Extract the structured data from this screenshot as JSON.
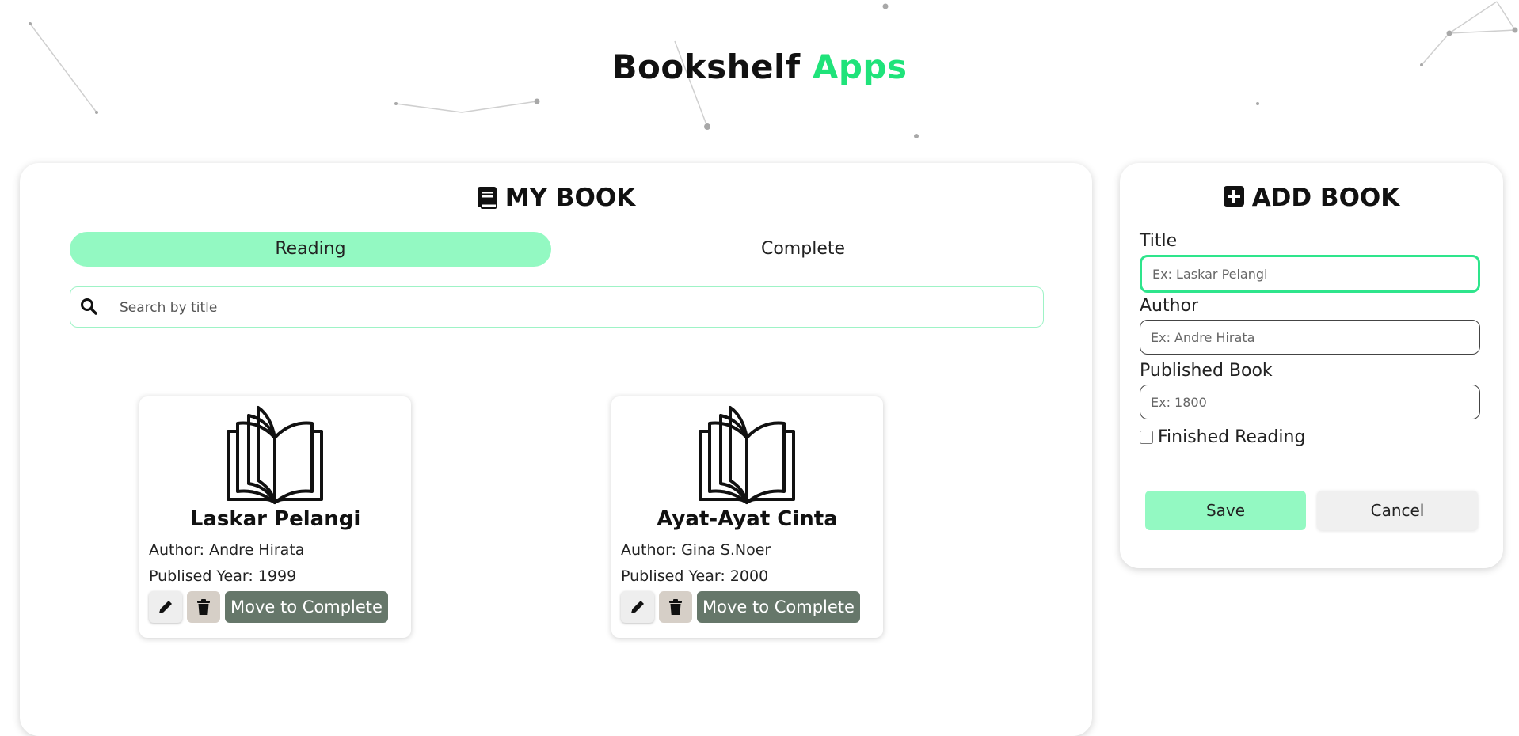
{
  "header": {
    "title_main": "Bookshelf",
    "title_accent": "Apps"
  },
  "colors": {
    "accent": "#1fe37a",
    "tab_active": "#93f9c2",
    "move_button": "#66776a",
    "input_focus": "#2ee58c"
  },
  "my_book": {
    "heading": "MY BOOK",
    "heading_icon": "book-icon",
    "tabs": [
      {
        "label": "Reading",
        "active": true
      },
      {
        "label": "Complete",
        "active": false
      }
    ],
    "search": {
      "placeholder": "Search by title",
      "icon": "search-icon",
      "value": ""
    },
    "books": [
      {
        "title": "Laskar Pelangi",
        "author": "Author: Andre Hirata",
        "year": "Publised Year: 1999",
        "move_label": "Move to Complete"
      },
      {
        "title": "Ayat-Ayat Cinta",
        "author": "Author: Gina S.Noer",
        "year": "Publised Year: 2000",
        "move_label": "Move to Complete"
      }
    ]
  },
  "add_book": {
    "heading": "ADD BOOK",
    "heading_icon": "plus-square-icon",
    "fields": {
      "title": {
        "label": "Title",
        "placeholder": "Ex: Laskar Pelangi",
        "value": ""
      },
      "author": {
        "label": "Author",
        "placeholder": "Ex: Andre Hirata",
        "value": ""
      },
      "published": {
        "label": "Published Book",
        "placeholder": "Ex: 1800",
        "value": ""
      }
    },
    "finished_label": "Finished Reading",
    "finished_checked": false,
    "save_label": "Save",
    "cancel_label": "Cancel"
  }
}
